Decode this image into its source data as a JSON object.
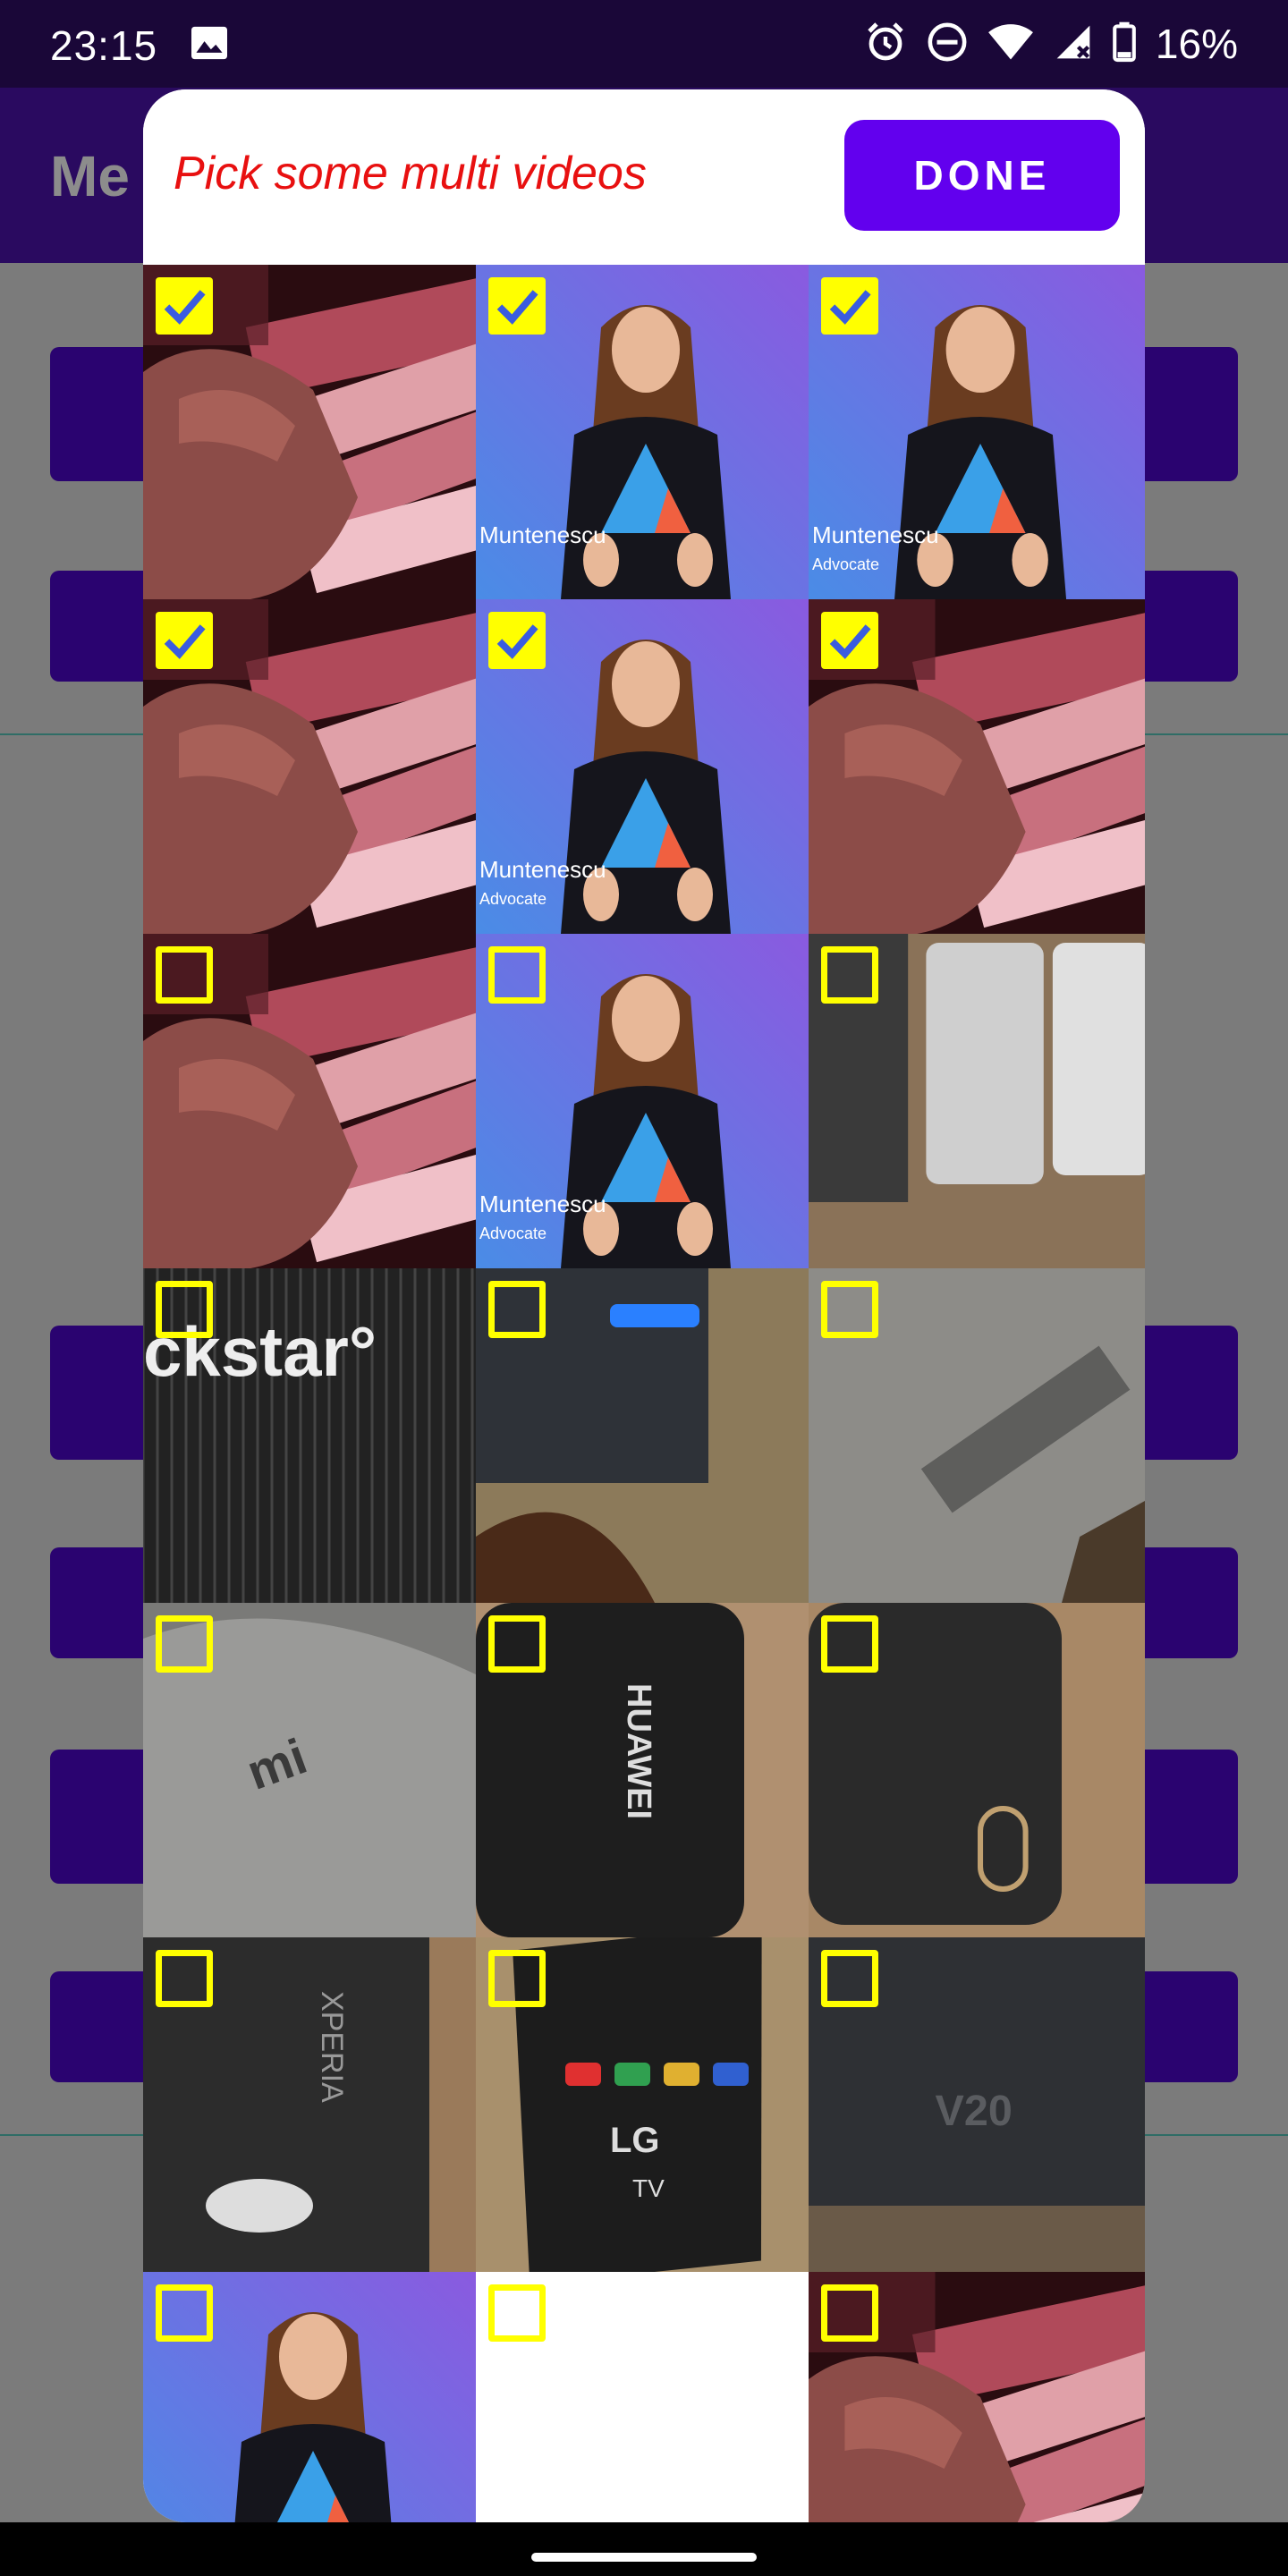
{
  "status_bar": {
    "time": "23:15",
    "battery": "16%",
    "icons": [
      "gallery-icon",
      "alarm-icon",
      "dnd-icon",
      "wifi-icon",
      "signal-icon",
      "battery-icon"
    ]
  },
  "background_app": {
    "title": "Me"
  },
  "dialog": {
    "title": "Pick some multi videos",
    "done_label": "DONE",
    "accent": "#6200ee",
    "title_color": "#e81010",
    "checkbox_color": "#ffff00"
  },
  "videos": [
    {
      "kind": "money",
      "checked": true
    },
    {
      "kind": "woman",
      "checked": true,
      "name": "Muntenescu",
      "role": ""
    },
    {
      "kind": "woman",
      "checked": true,
      "name": "Muntenescu",
      "role": "Advocate"
    },
    {
      "kind": "money",
      "checked": true
    },
    {
      "kind": "woman",
      "checked": true,
      "name": "Muntenescu",
      "role": "Advocate"
    },
    {
      "kind": "money",
      "checked": true
    },
    {
      "kind": "money",
      "checked": false
    },
    {
      "kind": "woman",
      "checked": false,
      "name": "Muntenescu",
      "role": "Advocate"
    },
    {
      "kind": "phones",
      "checked": false
    },
    {
      "kind": "speaker",
      "checked": false,
      "text": "ckstar°"
    },
    {
      "kind": "charger",
      "checked": false
    },
    {
      "kind": "grey-phone",
      "checked": false
    },
    {
      "kind": "mi-phone",
      "checked": false,
      "text": "mi"
    },
    {
      "kind": "huawei-phone",
      "checked": false,
      "text": "HUAWEI"
    },
    {
      "kind": "black-phone",
      "checked": false
    },
    {
      "kind": "xperia-phone",
      "checked": false,
      "text": "XPERIA"
    },
    {
      "kind": "remote",
      "checked": false,
      "text": "LG TV"
    },
    {
      "kind": "v20-phone",
      "checked": false,
      "text": "V20"
    },
    {
      "kind": "woman",
      "checked": false,
      "name": "",
      "role": ""
    },
    {
      "kind": "blank",
      "checked": false
    },
    {
      "kind": "money",
      "checked": false
    }
  ]
}
